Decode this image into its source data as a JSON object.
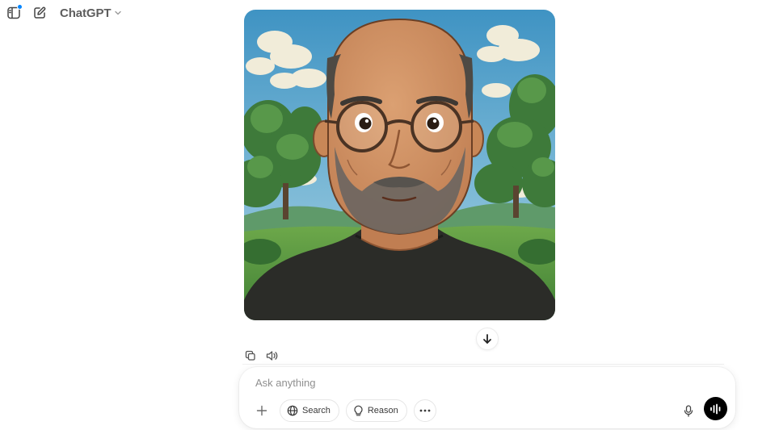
{
  "header": {
    "model_name": "ChatGPT",
    "has_notification": true
  },
  "icons": {
    "sidebar": "sidebar-toggle-icon",
    "new_chat": "edit-icon",
    "model_chevron": "chevron-down-icon",
    "copy": "copy-icon",
    "read_aloud": "speaker-icon",
    "scroll_down": "arrow-down-icon",
    "attach": "plus-icon",
    "search": "globe-icon",
    "reason": "lightbulb-icon",
    "more": "ellipsis-icon",
    "dictate": "microphone-icon",
    "voice_mode": "voice-wave-icon"
  },
  "conversation": {
    "image_description": "Ghibli-style portrait illustration"
  },
  "composer": {
    "placeholder": "Ask anything",
    "value": "",
    "tools": {
      "search_label": "Search",
      "reason_label": "Reason"
    }
  },
  "colors": {
    "accent_dot": "#0285ff",
    "voice_button": "#000000",
    "model_text": "#5d5d5d"
  }
}
